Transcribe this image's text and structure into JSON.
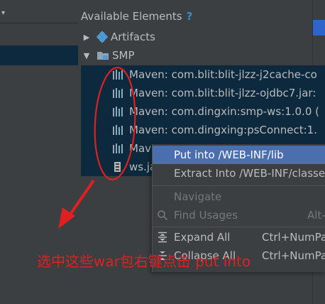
{
  "panel": {
    "title": "Available Elements",
    "help_icon_glyph": "?"
  },
  "tree": {
    "artifacts_label": "Artifacts",
    "smp_label": "SMP",
    "libraries": [
      {
        "label": "Maven: com.blit:blit-jlzz-j2cache-co",
        "icon": "library-icon"
      },
      {
        "label": "Maven: com.blit:blit-jlzz-ojdbc7.jar:",
        "icon": "library-icon"
      },
      {
        "label": "Maven: com.dingxin:smp-ws:1.0.0 (",
        "icon": "library-icon"
      },
      {
        "label": "Maven: com.dingxing:psConnect:1.",
        "icon": "library-icon"
      },
      {
        "label": "Mave",
        "icon": "library-icon"
      },
      {
        "label": "ws.ja",
        "icon": "jar-icon"
      }
    ]
  },
  "context_menu": {
    "items": [
      {
        "label": "Put into /WEB-INF/lib",
        "shortcut": "",
        "state": "active"
      },
      {
        "label": "Extract Into /WEB-INF/classes",
        "shortcut": "",
        "state": "normal"
      },
      {
        "label": "Navigate",
        "shortcut": "",
        "state": "disabled"
      },
      {
        "label": "Find Usages",
        "shortcut": "Alt-",
        "state": "disabled",
        "icon": "search-icon"
      },
      {
        "label": "Expand All",
        "shortcut": "Ctrl+NumPa",
        "state": "normal",
        "icon": "expand-all-icon"
      },
      {
        "label": "Collapse All",
        "shortcut": "Ctrl+NumPa",
        "state": "normal",
        "icon": "collapse-all-icon"
      }
    ]
  },
  "annotation": {
    "text": "选中这些war包右键点击 put into",
    "color": "#e02020"
  },
  "colors": {
    "background": "#3c3f41",
    "selection": "#0d293e",
    "menu_highlight": "#4b6eaf",
    "accent_blue": "#3592c4"
  }
}
